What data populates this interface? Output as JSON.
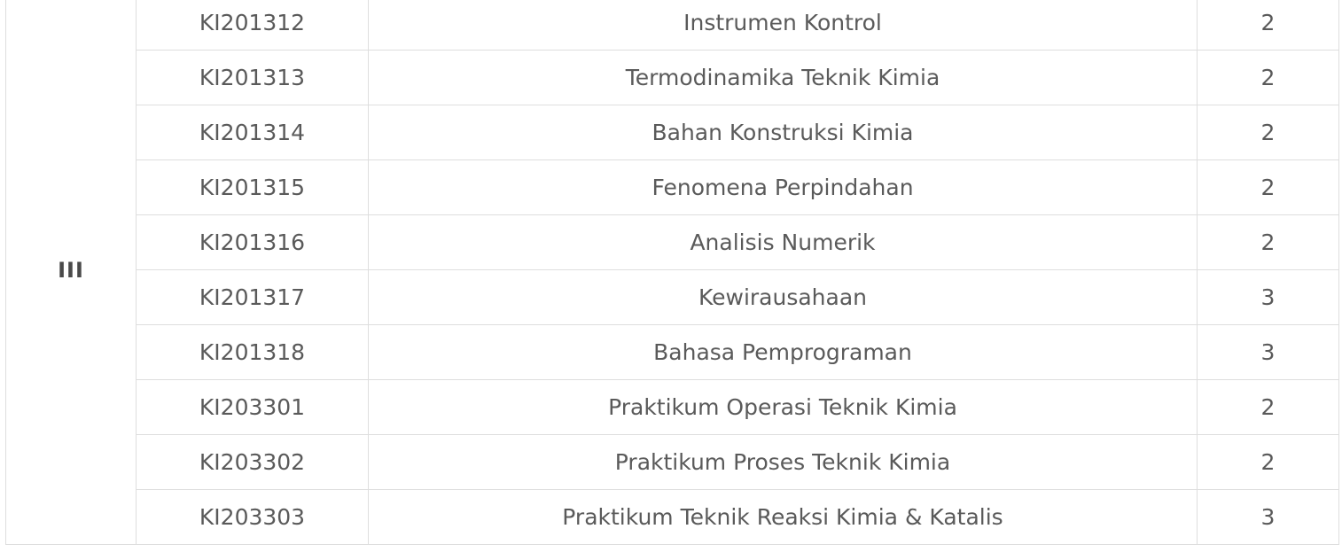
{
  "table": {
    "semester": "III",
    "rows": [
      {
        "code": "KI201312",
        "name": "Instrumen Kontrol",
        "sks": "2"
      },
      {
        "code": "KI201313",
        "name": "Termodinamika Teknik Kimia",
        "sks": "2"
      },
      {
        "code": "KI201314",
        "name": "Bahan Konstruksi Kimia",
        "sks": "2"
      },
      {
        "code": "KI201315",
        "name": "Fenomena Perpindahan",
        "sks": "2"
      },
      {
        "code": "KI201316",
        "name": "Analisis Numerik",
        "sks": "2"
      },
      {
        "code": "KI201317",
        "name": "Kewirausahaan",
        "sks": "3"
      },
      {
        "code": "KI201318",
        "name": "Bahasa Pemprograman",
        "sks": "3"
      },
      {
        "code": "KI203301",
        "name": "Praktikum Operasi Teknik Kimia",
        "sks": "2"
      },
      {
        "code": "KI203302",
        "name": "Praktikum Proses Teknik Kimia",
        "sks": "2"
      },
      {
        "code": "KI203303",
        "name": "Praktikum Teknik Reaksi Kimia & Katalis",
        "sks": "3"
      }
    ]
  }
}
